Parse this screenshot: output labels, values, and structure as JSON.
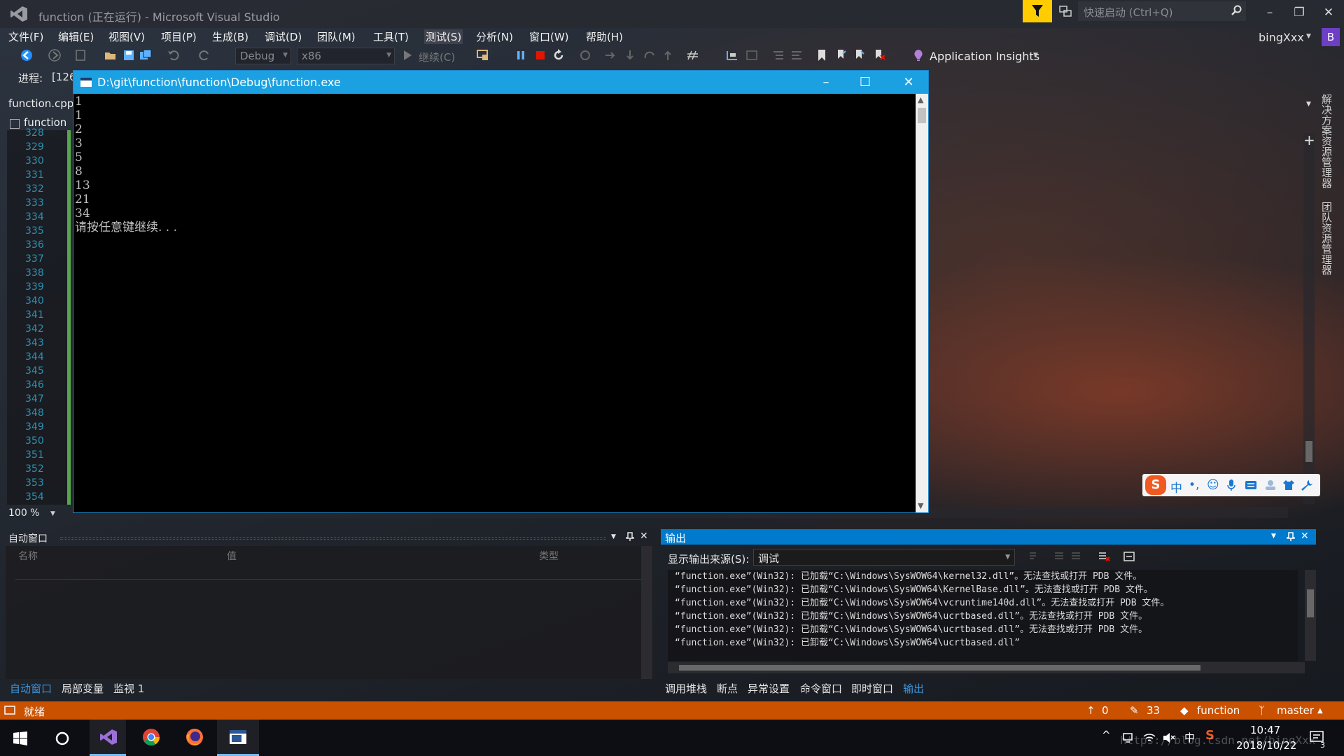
{
  "window": {
    "title": "function (正在运行) - Microsoft Visual Studio",
    "quick_launch_placeholder": "快速启动 (Ctrl+Q)",
    "user": "bingXxx",
    "user_badge": "B"
  },
  "menu": [
    "文件(F)",
    "编辑(E)",
    "视图(V)",
    "项目(P)",
    "生成(B)",
    "调试(D)",
    "团队(M)",
    "工具(T)",
    "测试(S)",
    "分析(N)",
    "窗口(W)",
    "帮助(H)"
  ],
  "toolbar": {
    "config": "Debug",
    "platform": "x86",
    "continue_label": "继续(C)",
    "app_insights": "Application Insights"
  },
  "process": {
    "label": "进程:",
    "value": "[126"
  },
  "editor": {
    "tab": "function.cpp",
    "nav_scope": "function",
    "line_numbers": [
      "328",
      "329",
      "330",
      "331",
      "332",
      "333",
      "334",
      "335",
      "336",
      "337",
      "338",
      "339",
      "340",
      "341",
      "342",
      "343",
      "344",
      "345",
      "346",
      "347",
      "348",
      "349",
      "350",
      "351",
      "352",
      "353",
      "354"
    ],
    "zoom": "100 %"
  },
  "side_tabs": [
    "解决方案资源管理器",
    "团队资源管理器"
  ],
  "console": {
    "title": "D:\\git\\function\\function\\Debug\\function.exe",
    "lines": [
      "1",
      "1",
      "2",
      "3",
      "5",
      "8",
      "13",
      "21",
      "34",
      "请按任意键继续. . ."
    ]
  },
  "autos": {
    "title": "自动窗口",
    "columns": [
      "名称",
      "值",
      "类型"
    ],
    "tabs": [
      "自动窗口",
      "局部变量",
      "监视 1"
    ]
  },
  "output": {
    "title": "输出",
    "source_label": "显示输出来源(S):",
    "source_value": "调试",
    "lines": [
      "“function.exe”(Win32): 已加载“C:\\Windows\\SysWOW64\\kernel32.dll”。无法查找或打开 PDB 文件。",
      "“function.exe”(Win32): 已加载“C:\\Windows\\SysWOW64\\KernelBase.dll”。无法查找或打开 PDB 文件。",
      "“function.exe”(Win32): 已加载“C:\\Windows\\SysWOW64\\vcruntime140d.dll”。无法查找或打开 PDB 文件。",
      "“function.exe”(Win32): 已加载“C:\\Windows\\SysWOW64\\ucrtbased.dll”。无法查找或打开 PDB 文件。",
      "“function.exe”(Win32): 已加载“C:\\Windows\\SysWOW64\\ucrtbased.dll”。无法查找或打开 PDB 文件。",
      "“function.exe”(Win32): 已卸载“C:\\Windows\\SysWOW64\\ucrtbased.dll”"
    ],
    "tabs": [
      "调用堆栈",
      "断点",
      "异常设置",
      "命令窗口",
      "即时窗口",
      "输出"
    ]
  },
  "status": {
    "text": "就绪",
    "up_count": "0",
    "edit_count": "33",
    "repo": "function",
    "branch": "master"
  },
  "taskbar": {
    "time": "10:47",
    "date": "2018/10/22",
    "ime": "中",
    "watermark": "https://blog.csdn.net/bingXxx"
  },
  "colors": {
    "status_bar": "#ca5100",
    "console_title": "#1ba1e2",
    "output_title": "#007acc",
    "filter_button": "#ffcc00"
  }
}
